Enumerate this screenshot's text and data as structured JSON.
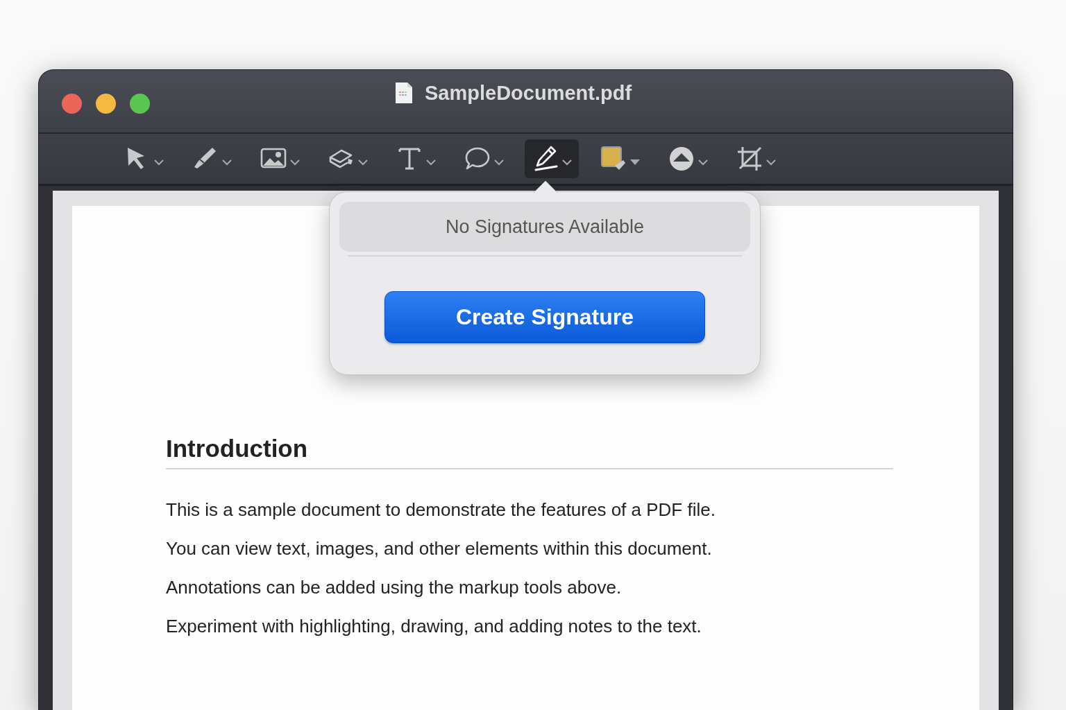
{
  "window": {
    "title": "SampleDocument.pdf"
  },
  "toolbar": [
    {
      "kind": "select",
      "selected": false
    },
    {
      "kind": "sketch",
      "selected": false
    },
    {
      "kind": "image",
      "selected": false
    },
    {
      "kind": "shapes",
      "selected": false
    },
    {
      "kind": "text",
      "selected": false
    },
    {
      "kind": "note",
      "selected": false
    },
    {
      "kind": "sign",
      "selected": true
    },
    {
      "kind": "color",
      "selected": false
    },
    {
      "kind": "style",
      "selected": false
    },
    {
      "kind": "crop",
      "selected": false
    }
  ],
  "popover": {
    "message": "No Signatures Available",
    "button": "Create Signature"
  },
  "document": {
    "heading": "Introduction",
    "paragraphs": [
      "This is a sample document to demonstrate the features of a PDF file.",
      "You can view text, images, and other elements within this document.",
      "Annotations can be added using the markup tools above.",
      "Experiment with highlighting, drawing, and adding notes to the text."
    ]
  }
}
